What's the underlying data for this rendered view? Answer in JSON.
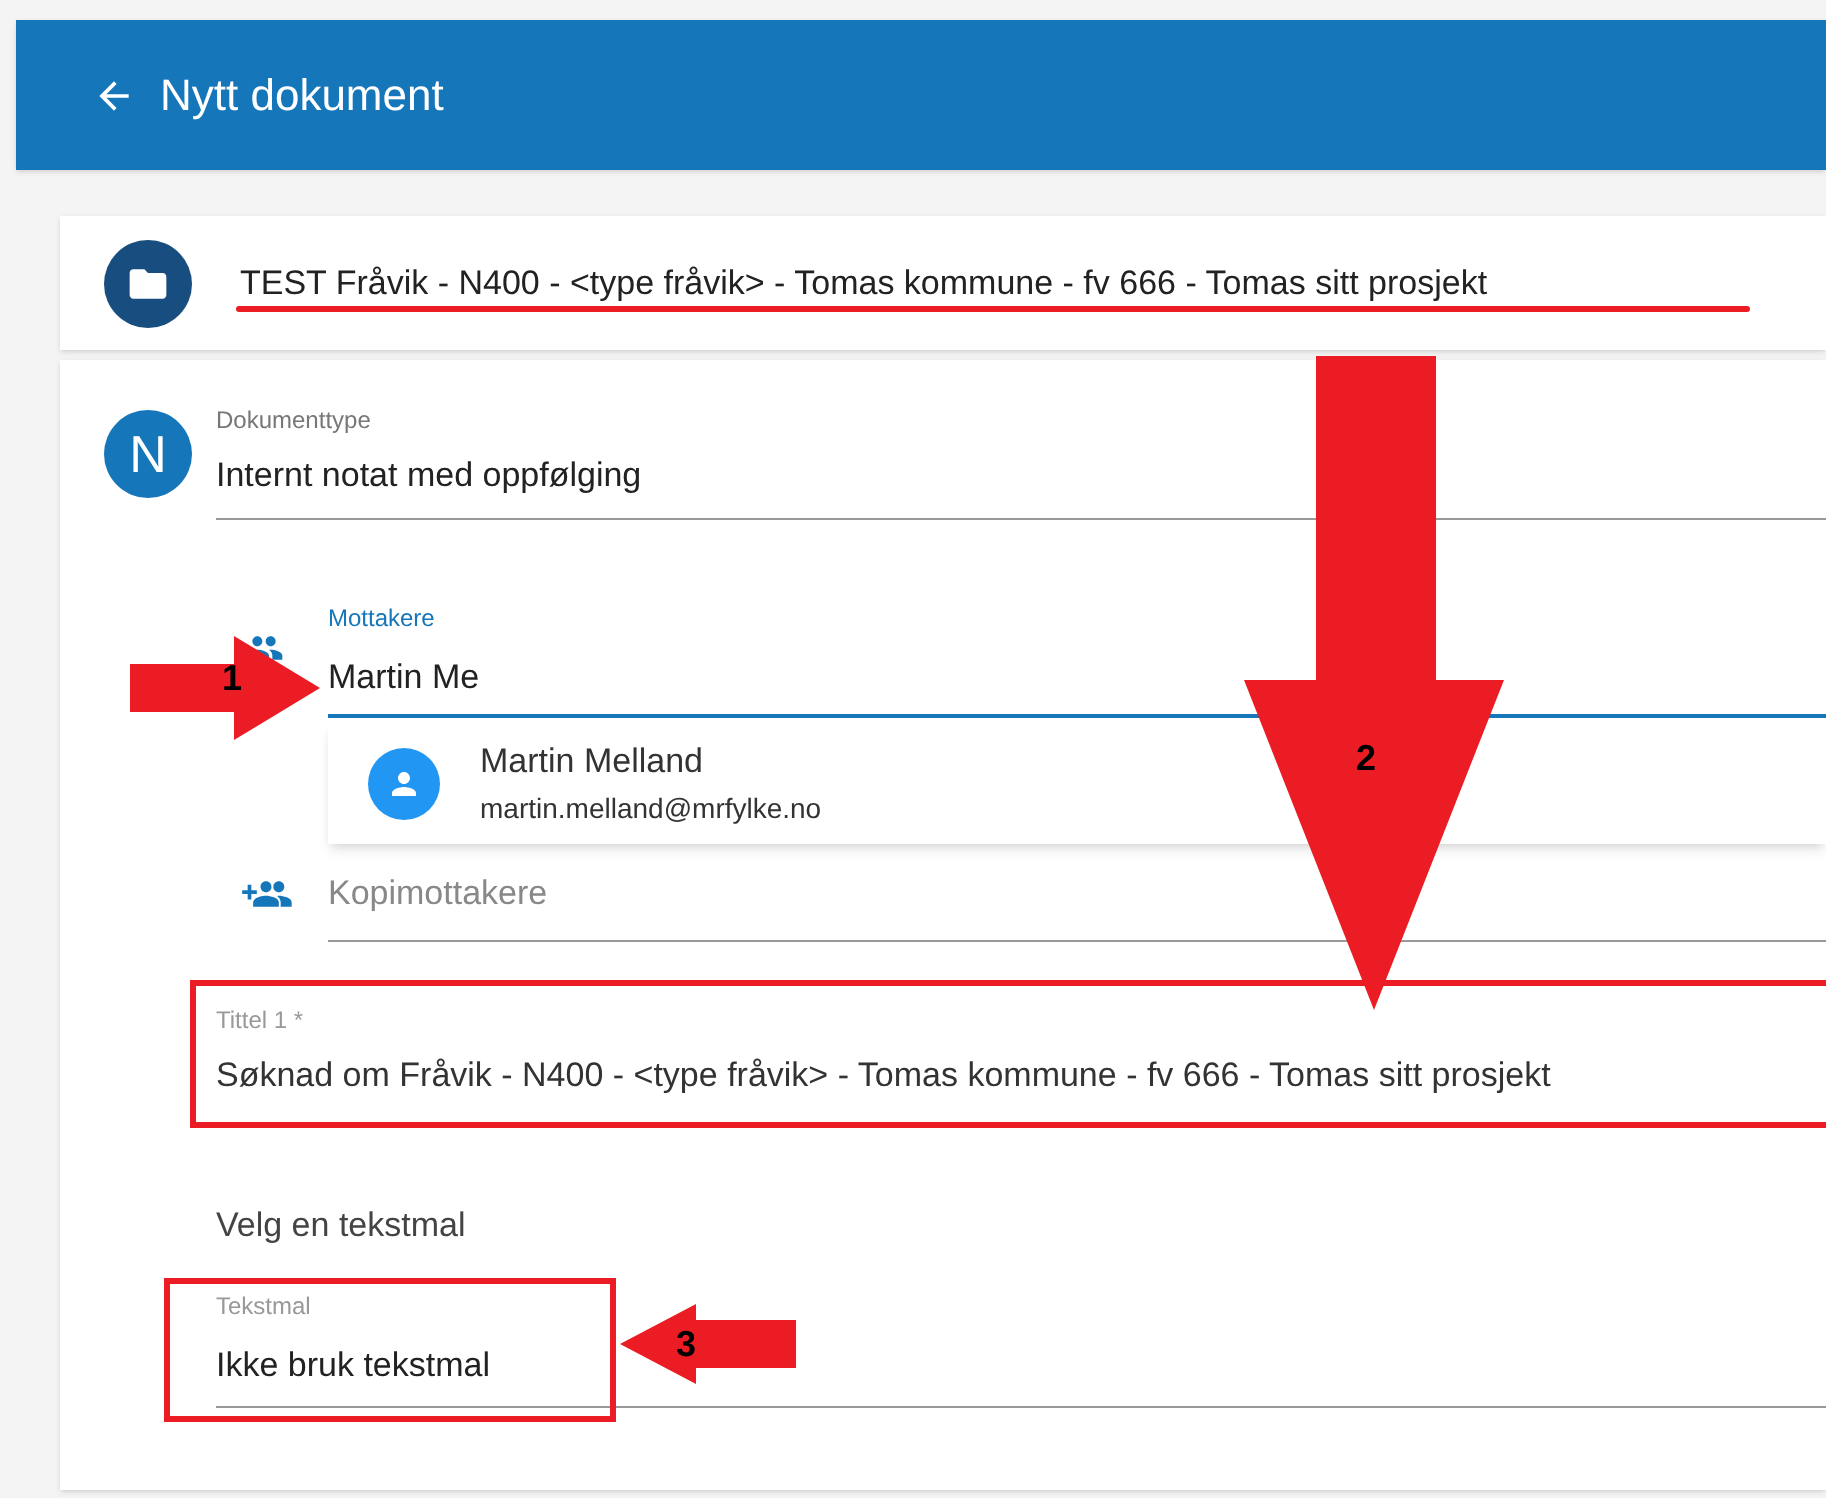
{
  "header": {
    "title": "Nytt dokument"
  },
  "case": {
    "title": "TEST Fråvik - N400 - <type fråvik> - Tomas kommune - fv 666 - Tomas sitt prosjekt"
  },
  "document_type": {
    "avatar": "N",
    "label": "Dokumenttype",
    "value": "Internt notat med oppfølging"
  },
  "recipients": {
    "label": "Mottakere",
    "value": "Martin Me",
    "focused": true
  },
  "suggestions": [
    {
      "name": "Martin Melland",
      "email": "martin.melland@mrfylke.no"
    }
  ],
  "copy_recipients": {
    "placeholder": "Kopimottakere"
  },
  "title_field": {
    "label": "Tittel 1 *",
    "value": "Søknad om Fråvik - N400 - <type fråvik> - Tomas kommune - fv 666 - Tomas sitt prosjekt"
  },
  "template_heading": "Velg en tekstmal",
  "template": {
    "label": "Tekstmal",
    "value": "Ikke bruk tekstmal"
  },
  "annotations": [
    {
      "kind": "right",
      "label": "1"
    },
    {
      "kind": "down",
      "label": "2"
    },
    {
      "kind": "left",
      "label": "3"
    }
  ]
}
